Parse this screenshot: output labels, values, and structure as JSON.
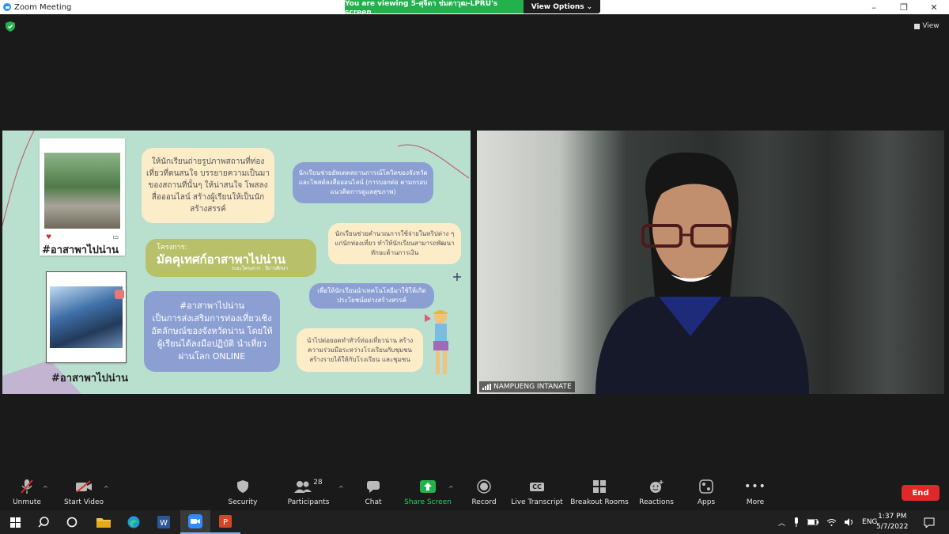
{
  "window": {
    "title": "Zoom Meeting",
    "minimize": "–",
    "restore": "❐",
    "close": "✕"
  },
  "share_banner": {
    "message": "You are viewing 5-ศุจิดา ช่มตาวุฒ-LPRU's screen",
    "view_options": "View Options"
  },
  "view_button": "View",
  "slide": {
    "text1": "ให้นักเรียนถ่ายรูปภาพสถานที่ท่องเที่ยวที่ตนสนใจ บรรยายความเป็นมาของสถานที่นั้นๆ ให้น่าสนใจ โพสลงสื่อออนไลน์ สร้างผู้เรียนให้เป็นนักสร้างสรรค์",
    "text2": "นักเรียนช่วยอัพเดตสถานการณ์โควิดของจังหวัดและโพสต์ลงสื่อออนไลน์ (การบอกต่อ ตามกรอบแนวคิดการดูแลสุขภาพ)",
    "project_prefix": "โครงการ:",
    "project_title": "มัคคุเทศก์อาสาพาไปน่าน",
    "project_sub": "ระยะโครงการ : ปีการศึกษา",
    "text3": "นักเรียนช่วยคำนวณการใช้จ่ายในทริปต่าง ๆ แก่นักท่องเที่ยว ทำให้นักเรียนสามารถพัฒนาทักษะด้านการเงิน",
    "text4_lines": [
      "#อาสาพาไปน่าน",
      "เป็นการส่งเสริมการท่องเที่ยวเชิง",
      "อัตลักษณ์ของจังหวัดน่าน โดยให้",
      "ผู้เรียนได้ลงมือปฏิบัติ นำเที่ยว",
      "ผ่านโลก ONLINE"
    ],
    "text5": "เพื่อให้นักเรียนนำเทคโนโลยีมาใช้ให้เกิดประโยชน์อย่างสร้างสรรค์",
    "text6": "นำไปต่อยอดทำทัวร์ท่องเที่ยวน่าน สร้างความร่วมมือระหว่างโรงเรียนกับชุมชน สร้างรายได้ให้กับโรงเรียน และชุมชน",
    "hashtag1": "#อาสาพาไปน่าน",
    "hashtag2": "#อาสาพาไปน่าน"
  },
  "video": {
    "participant_name": "NAMPUENG INTANATE"
  },
  "toolbar": {
    "unmute": "Unmute",
    "start_video": "Start Video",
    "security": "Security",
    "participants": "Participants",
    "participants_count": "28",
    "chat": "Chat",
    "share_screen": "Share Screen",
    "record": "Record",
    "live_transcript": "Live Transcript",
    "cc": "CC",
    "breakout_rooms": "Breakout Rooms",
    "reactions": "Reactions",
    "apps": "Apps",
    "more": "More",
    "end": "End"
  },
  "taskbar": {
    "lang": "ENG",
    "time": "1:37 PM",
    "date": "5/7/2022"
  },
  "colors": {
    "share_green": "#23b14d",
    "end_red": "#e02828",
    "slide_bg": "#b9dfcf"
  }
}
